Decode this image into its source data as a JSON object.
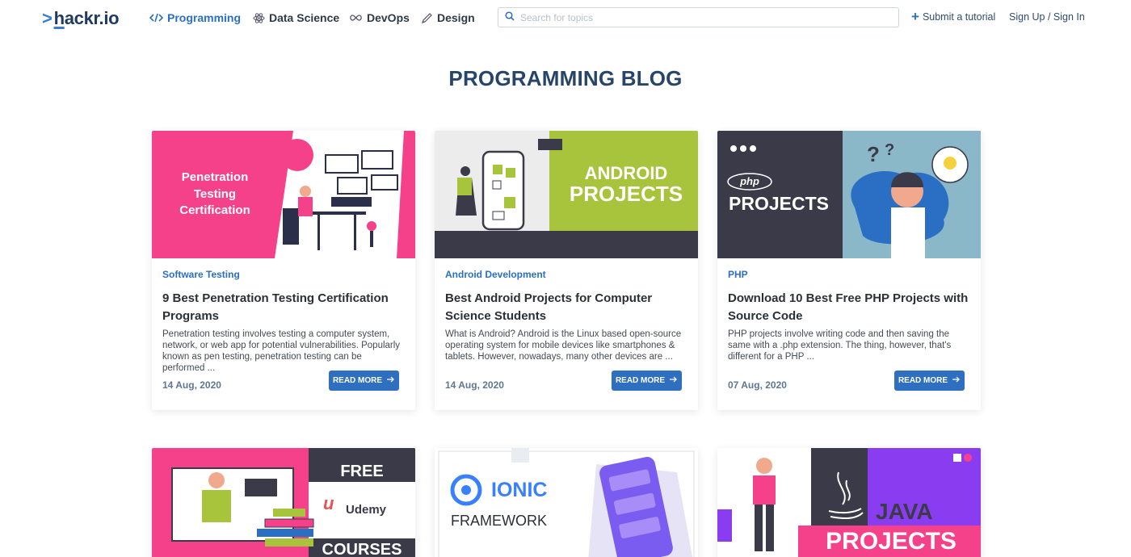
{
  "header": {
    "logo_caret": ">",
    "logo_text_1": "h",
    "logo_text_2": "ackr.io",
    "nav": [
      {
        "label": "Programming",
        "icon": "code-icon",
        "active": true
      },
      {
        "label": "Data Science",
        "icon": "atom-icon",
        "active": false
      },
      {
        "label": "DevOps",
        "icon": "infinity-icon",
        "active": false
      },
      {
        "label": "Design",
        "icon": "pen-icon",
        "active": false
      }
    ],
    "search_placeholder": "Search for topics",
    "submit_label": "Submit a tutorial",
    "signin_label": "Sign Up / Sign In"
  },
  "page_title": "PROGRAMMING BLOG",
  "cards": [
    {
      "thumb_text": "Penetration Testing Certification",
      "category": "Software Testing",
      "title": "9 Best Penetration Testing Certification Programs",
      "excerpt": "Penetration testing involves testing a computer system, network, or web app for potential vulnerabilities. Popularly known as pen testing, penetration testing can be performed ...",
      "date": "14 Aug, 2020",
      "read_more": "READ MORE"
    },
    {
      "thumb_text_1": "ANDROID",
      "thumb_text_2": "PROJECTS",
      "category": "Android Development",
      "title": "Best Android Projects for Computer Science Students",
      "excerpt": "What is Android? Android is the Linux based open-source operating system for mobile devices like smartphones & tablets. However, nowadays, many other devices are ...",
      "date": "14 Aug, 2020",
      "read_more": "READ MORE"
    },
    {
      "thumb_badge": "php",
      "thumb_text": "PROJECTS",
      "category": "PHP",
      "title": "Download 10 Best Free PHP Projects with Source Code",
      "excerpt": "PHP projects involve writing code and then saving the same with a .php extension. The thing, however, that's different for a PHP ...",
      "date": "07 Aug, 2020",
      "read_more": "READ MORE"
    }
  ],
  "bottom_cards": [
    {
      "text_1": "FREE",
      "text_2": "Udemy",
      "text_3": "COURSES"
    },
    {
      "text_1": "IONIC",
      "text_2": "FRAMEWORK"
    },
    {
      "text_1": "JAVA",
      "text_2": "PROJECTS"
    }
  ],
  "colors": {
    "accent": "#2f6fc0",
    "title": "#27456b",
    "pink": "#f5418a",
    "lime": "#a8c43c",
    "dark": "#3a3a48",
    "purple": "#8a3df0"
  }
}
